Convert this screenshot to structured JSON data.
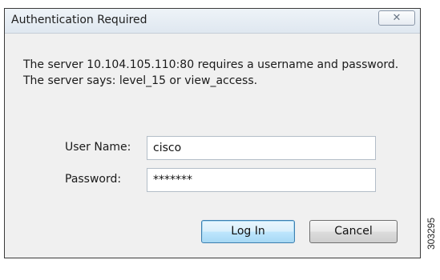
{
  "dialog": {
    "title": "Authentication Required",
    "close_glyph": "✕",
    "message": "The server 10.104.105.110:80 requires a username and password. The server says: level_15 or view_access.",
    "fields": {
      "username_label": "User Name:",
      "username_value": "cisco",
      "password_label": "Password:",
      "password_value": "*******"
    },
    "buttons": {
      "login": "Log In",
      "cancel": "Cancel"
    }
  },
  "figure_number": "303295",
  "icons": [
    "close-icon"
  ],
  "colors": {
    "dialog_bg": "#f0f0f0",
    "default_button_border": "#3c7fb1"
  }
}
